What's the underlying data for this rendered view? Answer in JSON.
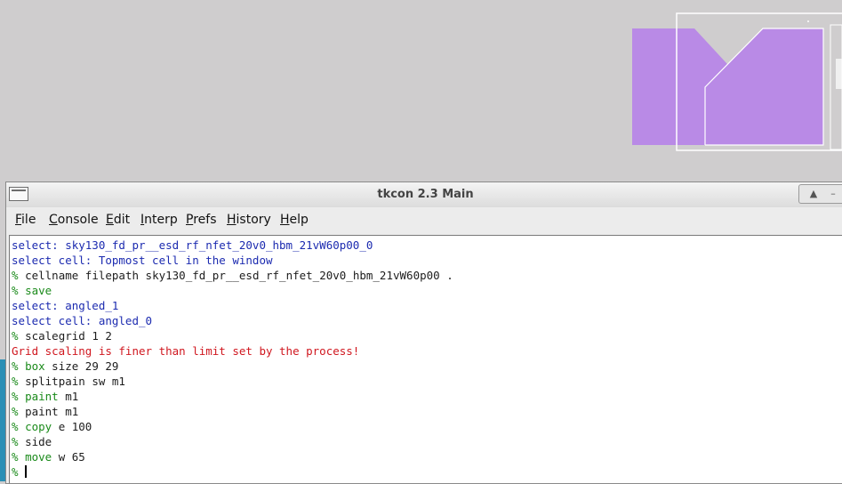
{
  "window": {
    "title": "tkcon 2.3 Main",
    "controls": {
      "maximize_glyph": "▲",
      "minimize_glyph": "–"
    }
  },
  "menubar": {
    "items": [
      {
        "label": "File",
        "underline": "F",
        "rest": "ile"
      },
      {
        "label": "Console",
        "underline": "C",
        "rest": "onsole"
      },
      {
        "label": "Edit",
        "underline": "E",
        "rest": "dit"
      },
      {
        "label": "Interp",
        "underline": "I",
        "rest": "nterp"
      },
      {
        "label": "Prefs",
        "underline": "P",
        "rest": "refs"
      },
      {
        "label": "History",
        "underline": "H",
        "rest": "istory"
      },
      {
        "label": "Help",
        "underline": "H",
        "rest": "elp"
      }
    ]
  },
  "console": {
    "lines": [
      {
        "prompt": "",
        "cmd": "",
        "args": "select: sky130_fd_pr__esd_rf_nfet_20v0_hbm_21vW60p00_0",
        "style": "blue"
      },
      {
        "prompt": "",
        "cmd": "",
        "args": "select cell: Topmost cell in the window",
        "style": "blue"
      },
      {
        "prompt": "% ",
        "cmd": "cellname",
        "args": " filepath sky130_fd_pr__esd_rf_nfet_20v0_hbm_21vW60p00 .",
        "style": "cmd-black"
      },
      {
        "prompt": "% ",
        "cmd": "save",
        "args": "",
        "style": "cmd-green"
      },
      {
        "prompt": "",
        "cmd": "",
        "args": "select: angled_1",
        "style": "blue"
      },
      {
        "prompt": "",
        "cmd": "",
        "args": "select cell: angled_0",
        "style": "blue"
      },
      {
        "prompt": "% ",
        "cmd": "scalegrid",
        "args": " 1 2",
        "style": "cmd-black"
      },
      {
        "prompt": "",
        "cmd": "",
        "args": "Grid scaling is finer than limit set by the process!",
        "style": "red"
      },
      {
        "prompt": "% ",
        "cmd": "box",
        "args": " size 29 29",
        "style": "cmd-green"
      },
      {
        "prompt": "% ",
        "cmd": "splitpain",
        "args": " sw m1",
        "style": "cmd-black"
      },
      {
        "prompt": "% ",
        "cmd": "paint",
        "args": " m1",
        "style": "cmd-green"
      },
      {
        "prompt": "% ",
        "cmd": "paint",
        "args": " m1",
        "style": "cmd-black"
      },
      {
        "prompt": "% ",
        "cmd": "copy",
        "args": " e 100",
        "style": "cmd-green"
      },
      {
        "prompt": "% ",
        "cmd": "side",
        "args": "",
        "style": "cmd-black"
      },
      {
        "prompt": "% ",
        "cmd": "move",
        "args": " w 65",
        "style": "cmd-green"
      },
      {
        "prompt": "% ",
        "cmd": "",
        "args": "",
        "style": "input"
      }
    ]
  },
  "colors": {
    "layout_background": "#cfcdce",
    "metal1": "#b98ae6",
    "selection_box": "#ffffff",
    "prompt_green": "#1a8a1a",
    "info_blue": "#1c2bb0",
    "error_red": "#d0171f"
  }
}
